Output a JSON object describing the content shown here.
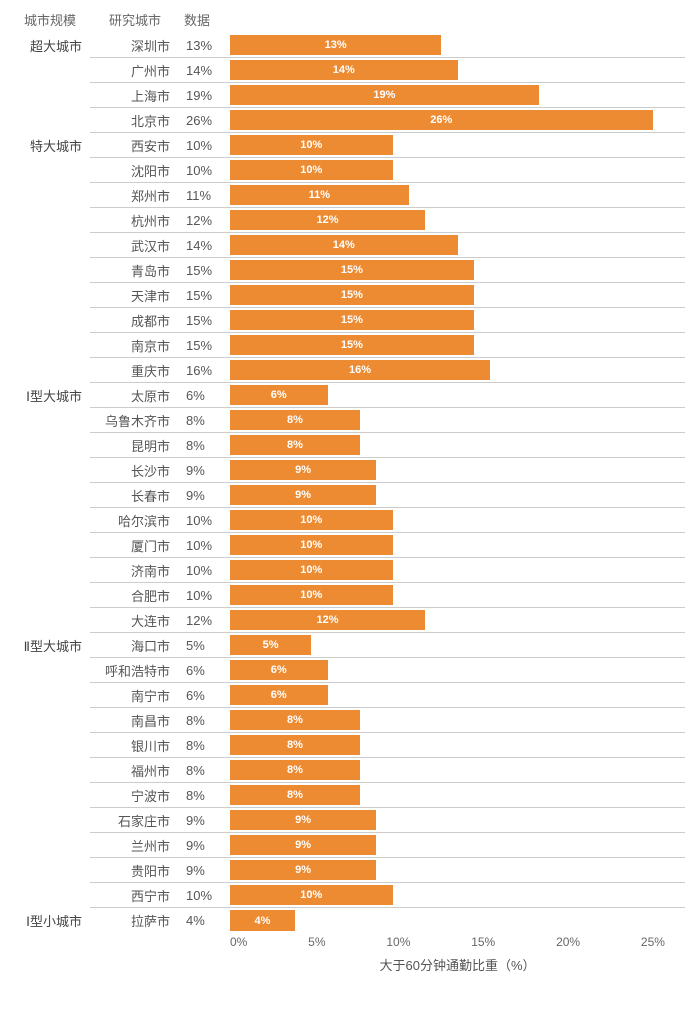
{
  "chart_data": {
    "type": "bar",
    "title": "",
    "xlabel": "大于60分钟通勤比重（%）",
    "ylabel": "",
    "xlim": [
      0,
      28
    ],
    "ticks": [
      "0%",
      "5%",
      "10%",
      "15%",
      "20%",
      "25%"
    ],
    "columns": [
      "城市规模",
      "研究城市",
      "数据"
    ],
    "bar_color": "#ED8B33",
    "series": [
      {
        "name": "超大城市",
        "items": [
          {
            "city": "深圳市",
            "value": 13
          },
          {
            "city": "广州市",
            "value": 14
          },
          {
            "city": "上海市",
            "value": 19
          },
          {
            "city": "北京市",
            "value": 26
          }
        ]
      },
      {
        "name": "特大城市",
        "items": [
          {
            "city": "西安市",
            "value": 10
          },
          {
            "city": "沈阳市",
            "value": 10
          },
          {
            "city": "郑州市",
            "value": 11
          },
          {
            "city": "杭州市",
            "value": 12
          },
          {
            "city": "武汉市",
            "value": 14
          },
          {
            "city": "青岛市",
            "value": 15
          },
          {
            "city": "天津市",
            "value": 15
          },
          {
            "city": "成都市",
            "value": 15
          },
          {
            "city": "南京市",
            "value": 15
          },
          {
            "city": "重庆市",
            "value": 16
          }
        ]
      },
      {
        "name": "Ⅰ型大城市",
        "items": [
          {
            "city": "太原市",
            "value": 6
          },
          {
            "city": "乌鲁木齐市",
            "value": 8
          },
          {
            "city": "昆明市",
            "value": 8
          },
          {
            "city": "长沙市",
            "value": 9
          },
          {
            "city": "长春市",
            "value": 9
          },
          {
            "city": "哈尔滨市",
            "value": 10
          },
          {
            "city": "厦门市",
            "value": 10
          },
          {
            "city": "济南市",
            "value": 10
          },
          {
            "city": "合肥市",
            "value": 10
          },
          {
            "city": "大连市",
            "value": 12
          }
        ]
      },
      {
        "name": "Ⅱ型大城市",
        "items": [
          {
            "city": "海口市",
            "value": 5
          },
          {
            "city": "呼和浩特市",
            "value": 6
          },
          {
            "city": "南宁市",
            "value": 6
          },
          {
            "city": "南昌市",
            "value": 8
          },
          {
            "city": "银川市",
            "value": 8
          },
          {
            "city": "福州市",
            "value": 8
          },
          {
            "city": "宁波市",
            "value": 8
          },
          {
            "city": "石家庄市",
            "value": 9
          },
          {
            "city": "兰州市",
            "value": 9
          },
          {
            "city": "贵阳市",
            "value": 9
          },
          {
            "city": "西宁市",
            "value": 10
          }
        ]
      },
      {
        "name": "Ⅰ型小城市",
        "items": [
          {
            "city": "拉萨市",
            "value": 4
          }
        ]
      }
    ]
  }
}
